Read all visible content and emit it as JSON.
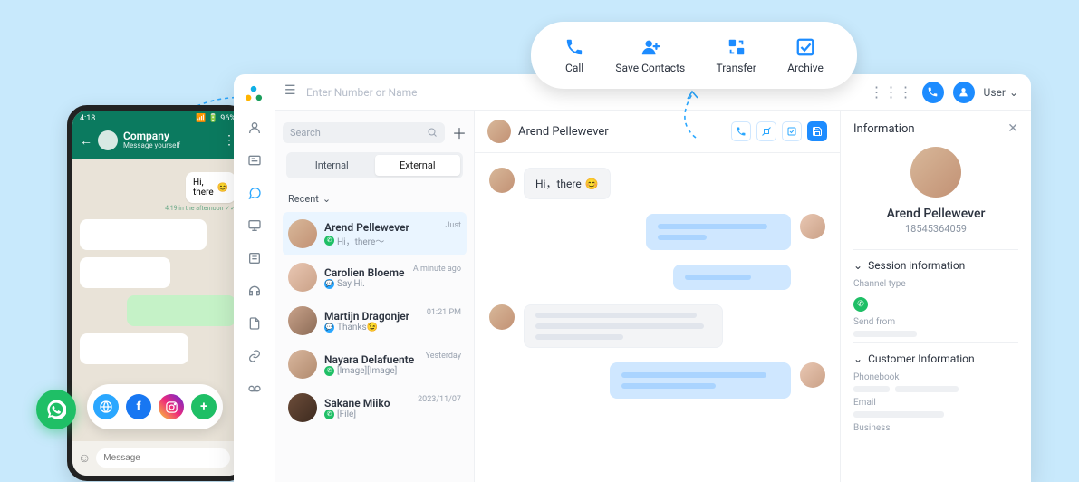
{
  "phone": {
    "status_time": "4:18",
    "status_right": "96%",
    "title": "Company",
    "subtitle": "Message yourself",
    "bubble_text": "Hi, there",
    "bubble_stamp": "4:19 in the afternoon ✓✓",
    "input_placeholder": "Message"
  },
  "popup": {
    "call": "Call",
    "save": "Save Contacts",
    "transfer": "Transfer",
    "archive": "Archive"
  },
  "top": {
    "search_placeholder": "Enter Number or Name",
    "user_label": "User"
  },
  "list": {
    "search_placeholder": "Search",
    "tab_internal": "Internal",
    "tab_external": "External",
    "recent_label": "Recent",
    "sessions": [
      {
        "name": "Arend Pellewever",
        "sub": "Hi，there～",
        "time": "Just",
        "ch": "wa"
      },
      {
        "name": "Carolien Bloeme",
        "sub": "Say Hi.",
        "time": "A minute ago",
        "ch": "sms"
      },
      {
        "name": "Martijn Dragonjer",
        "sub": "Thanks😉",
        "time": "01:21 PM",
        "ch": "sms"
      },
      {
        "name": "Nayara Delafuente",
        "sub": "[Image][Image]",
        "time": "Yesterday",
        "ch": "wa"
      },
      {
        "name": "Sakane Miiko",
        "sub": "[File]",
        "time": "2023/11/07",
        "ch": "wa"
      }
    ]
  },
  "chat": {
    "header_name": "Arend Pellewever",
    "msg1": "Hi，there"
  },
  "info": {
    "title": "Information",
    "name": "Arend Pellewever",
    "number": "18545364059",
    "sec_session": "Session information",
    "channel_label": "Channel type",
    "send_label": "Send from",
    "sec_customer": "Customer Information",
    "phonebook": "Phonebook",
    "email": "Email",
    "business": "Business"
  }
}
